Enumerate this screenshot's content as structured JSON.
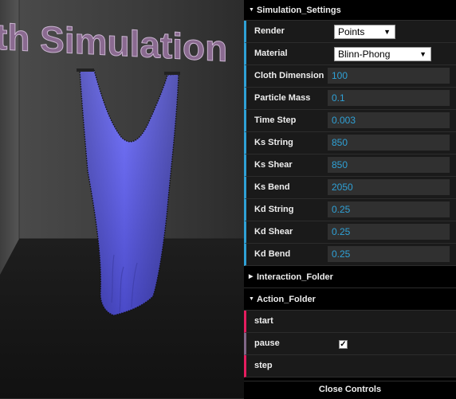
{
  "scene": {
    "title": "th Simulation",
    "cloth_color": "#6c6cf0",
    "background": "#2a2a2a"
  },
  "gui": {
    "simulation_folder": {
      "title": "Simulation_Settings",
      "render": {
        "label": "Render",
        "value": "Points"
      },
      "material": {
        "label": "Material",
        "value": "Blinn-Phong"
      },
      "params": [
        {
          "label": "Cloth Dimension",
          "value": "100"
        },
        {
          "label": "Particle Mass",
          "value": "0.1"
        },
        {
          "label": "Time Step",
          "value": "0.003"
        },
        {
          "label": "Ks String",
          "value": "850"
        },
        {
          "label": "Ks Shear",
          "value": "850"
        },
        {
          "label": "Ks Bend",
          "value": "2050"
        },
        {
          "label": "Kd String",
          "value": "0.25"
        },
        {
          "label": "Kd Shear",
          "value": "0.25"
        },
        {
          "label": "Kd Bend",
          "value": "0.25"
        }
      ]
    },
    "interaction_folder": {
      "title": "Interaction_Folder"
    },
    "action_folder": {
      "title": "Action_Folder",
      "start_label": "start",
      "pause_label": "pause",
      "pause_checked": true,
      "step_label": "step"
    },
    "close_label": "Close Controls",
    "accent_color": "#2fa1d6",
    "function_color": "#e61d5f"
  }
}
